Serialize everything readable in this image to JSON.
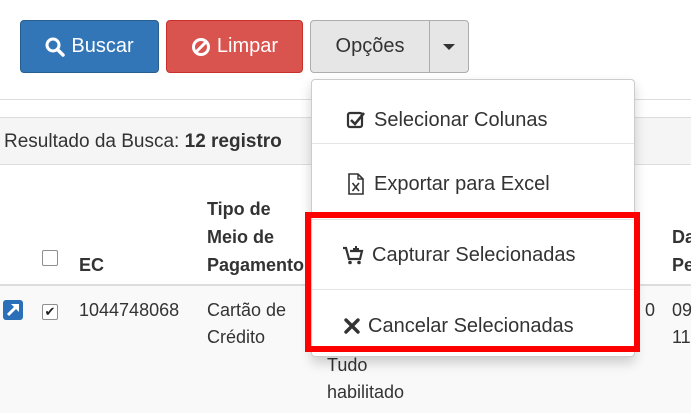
{
  "toolbar": {
    "buscar_label": "Buscar",
    "limpar_label": "Limpar",
    "opcoes_label": "Opções"
  },
  "result": {
    "prefix": "Resultado da Busca:",
    "count_text": "12 registro"
  },
  "table": {
    "headers": {
      "ec": "EC",
      "tipo_line1": "Tipo de",
      "tipo_line2": "Meio de",
      "tipo_line3": "Pagamento",
      "partial1_line1": "Da",
      "partial1_line2": "Pe"
    },
    "row": {
      "ec": "1044748068",
      "tipo_line1": "Cartão de",
      "tipo_line2": "Crédito",
      "hidden_line1": "Tudo",
      "hidden_line2": "habilitado",
      "partial_num": "0",
      "partial_date1": "09",
      "partial_date2": "11"
    }
  },
  "dropdown": {
    "items": [
      {
        "label": "Selecionar Colunas",
        "icon": "check-square-icon"
      },
      {
        "label": "Exportar para Excel",
        "icon": "excel-file-icon"
      },
      {
        "label": "Capturar Selecionadas",
        "icon": "cart-plus-icon"
      },
      {
        "label": "Cancelar Selecionadas",
        "icon": "times-icon"
      }
    ]
  },
  "colors": {
    "primary": "#3276b8",
    "danger": "#d9534f",
    "default": "#e6e6e6",
    "highlight": "#ff0000"
  }
}
